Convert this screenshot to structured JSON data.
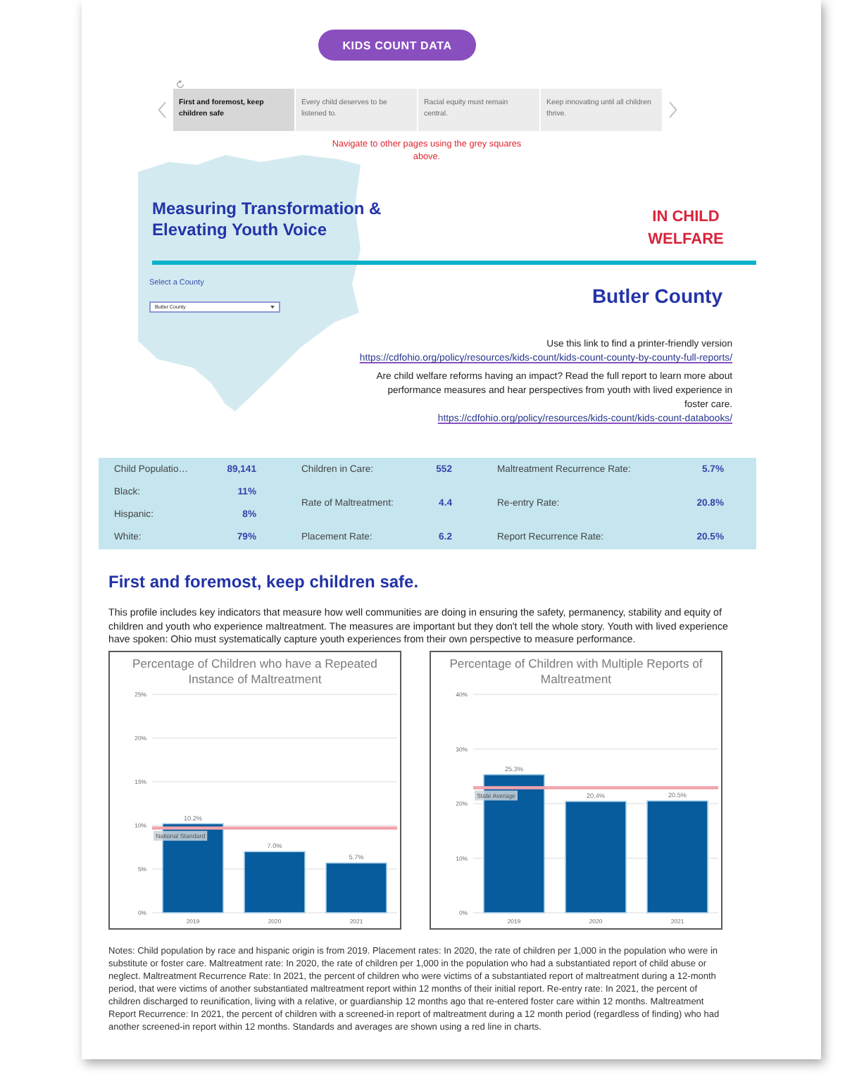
{
  "header_button": {
    "label": "KIDS COUNT DATA"
  },
  "page_tabs": [
    {
      "label": "First and foremost, keep children safe",
      "selected": true
    },
    {
      "label": "Every child deserves to be listened to.",
      "selected": false
    },
    {
      "label": "Racial equity must remain central.",
      "selected": false
    },
    {
      "label": "Keep innovating until all children thrive.",
      "selected": false
    }
  ],
  "nav_hint": "Navigate to other pages using the grey squares above.",
  "title": "Measuring Transformation & Elevating Youth Voice",
  "subtitle": "IN CHILD WELFARE",
  "county_select": {
    "label": "Select a County",
    "value": "Butler County"
  },
  "county_heading": "Butler County",
  "printer_note": {
    "text": "Use this link to find a printer-friendly version",
    "link": "https://cdfohio.org/policy/resources/kids-count/kids-count-county-by-county-full-reports/"
  },
  "report_note": {
    "text": "Are child welfare reforms having an impact? Read the full report to learn more about performance measures and hear perspectives from youth with lived experience in foster care.",
    "link": "https://cdfohio.org/policy/resources/kids-count/kids-count-databooks/"
  },
  "stat_columns": [
    [
      {
        "label": "Child Populatio…",
        "value": "89,141"
      },
      {
        "label": "Black:",
        "value": "11%"
      },
      {
        "label": "Hispanic:",
        "value": "8%"
      },
      {
        "label": "White:",
        "value": "79%"
      }
    ],
    [
      {
        "label": "Children in Care:",
        "value": "552"
      },
      {
        "label": "Rate of Maltreatment:",
        "value": "4.4"
      },
      {
        "label": "Placement Rate:",
        "value": "6.2"
      }
    ],
    [
      {
        "label": "Maltreatment Recurrence Rate:",
        "value": "5.7%"
      },
      {
        "label": "Re-entry Rate:",
        "value": "20.8%"
      },
      {
        "label": "Report Recurrence Rate:",
        "value": "20.5%"
      }
    ]
  ],
  "section": {
    "heading": "First and foremost, keep children safe.",
    "intro": "This profile includes key indicators that measure how well communities are doing in ensuring the safety, permanency, stability and equity of children and youth who experience maltreatment. The measures are important but they don't tell the whole story. Youth with lived experience have spoken: Ohio must systematically capture youth experiences from their own perspective to measure performance."
  },
  "charts": [
    {
      "chart_data": {
        "type": "bar",
        "title": "Percentage of Children who have a Repeated Instance of Maltreatment",
        "categories": [
          "2019",
          "2020",
          "2021"
        ],
        "values": [
          10.2,
          7.0,
          5.7
        ],
        "ylim": [
          0,
          25
        ],
        "yticks": [
          {
            "value": 0,
            "label": "0%"
          },
          {
            "value": 5,
            "label": "5%"
          },
          {
            "value": 10,
            "label": "10%"
          },
          {
            "value": 15,
            "label": "15%"
          },
          {
            "value": 20,
            "label": "20%"
          },
          {
            "value": 25,
            "label": "25%"
          }
        ],
        "grid": true,
        "value_labels": [
          "10.2%",
          "7.0%",
          "5.7%"
        ],
        "ref_lines": [
          {
            "axis": "y",
            "value": 9.7,
            "label": "National Standard"
          }
        ]
      }
    },
    {
      "chart_data": {
        "type": "bar",
        "title": "Percentage of Children with Multiple Reports of Maltreatment",
        "categories": [
          "2019",
          "2020",
          "2021"
        ],
        "values": [
          25.3,
          20.4,
          20.5
        ],
        "ylim": [
          0,
          40
        ],
        "yticks": [
          {
            "value": 0,
            "label": "0%"
          },
          {
            "value": 10,
            "label": "10%"
          },
          {
            "value": 20,
            "label": "20%"
          },
          {
            "value": 30,
            "label": "30%"
          },
          {
            "value": 40,
            "label": "40%"
          }
        ],
        "grid": true,
        "value_labels": [
          "25.3%",
          "20.4%",
          "20.5%"
        ],
        "ref_lines": [
          {
            "axis": "y",
            "value": 22.9,
            "label": "State Average"
          }
        ]
      }
    }
  ],
  "notes": "Notes: Child population by race and hispanic origin is from 2019. Placement rates: In 2020, the rate of children per 1,000 in the population who were in substitute or foster care. Maltreatment rate: In 2020, the rate of children per 1,000 in the population who had a substantiated report of child abuse or neglect. Maltreatment Recurrence Rate: In 2021, the percent of children who were victims of a substantiated report of maltreatment during a 12-month period, that were victims of another substantiated maltreatment report within 12 months of their initial report. Re-entry rate: In 2021, the percent of children discharged to reunification, living with a relative, or guardianship 12 months ago that re-entered foster care within 12 months. Maltreatment Report Recurrence: In 2021, the percent of children with a screened-in report of maltreatment during a 12 month period (regardless of finding) who had another screened-in report within 12 months. Standards and averages are shown using a red line in charts."
}
